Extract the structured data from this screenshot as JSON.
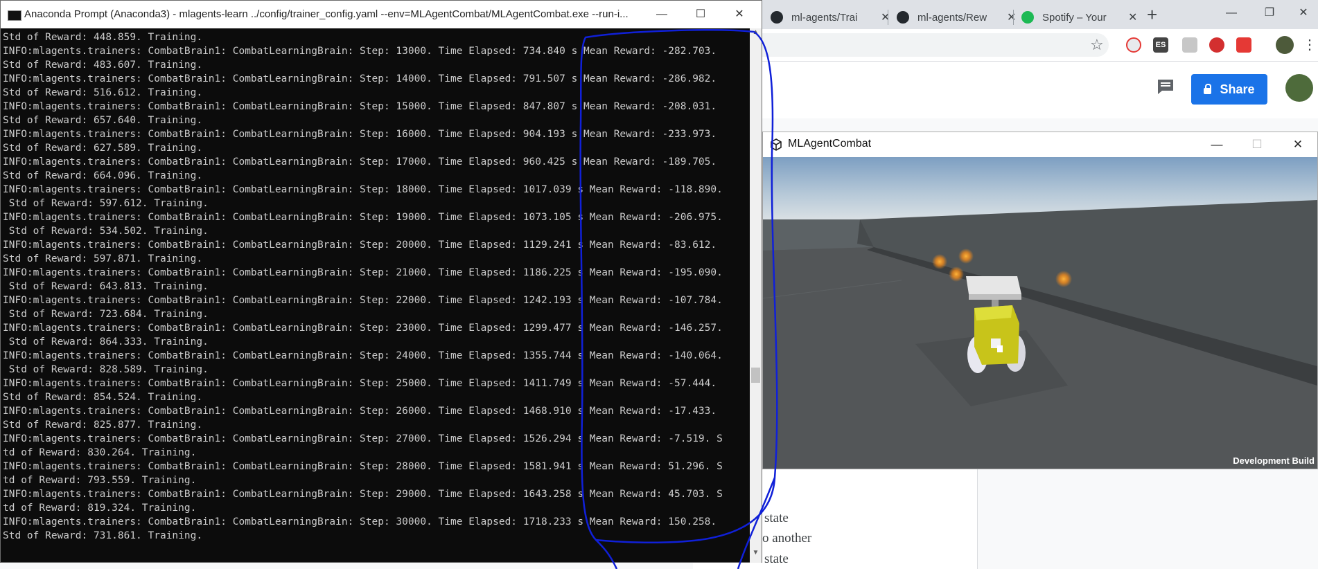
{
  "browser": {
    "tabs": [
      {
        "label": "ml-agents/Trai",
        "icon": "github-icon"
      },
      {
        "label": "ml-agents/Rew",
        "icon": "github-icon"
      },
      {
        "label": "Spotify – Your",
        "icon": "spotify-icon"
      }
    ],
    "tab_close": "✕",
    "new_tab": "+",
    "extensions": [
      "ES"
    ],
    "share_label": "Share",
    "colors": {
      "share": "#1a73e8",
      "spotify": "#1db954"
    }
  },
  "document": {
    "lines": [
      "state",
      "o another",
      "state"
    ]
  },
  "console": {
    "title": "Anaconda Prompt (Anaconda3) - mlagents-learn ../config/trainer_config.yaml --env=MLAgentCombat/MLAgentCombat.exe --run-i...",
    "lines": [
      "Std of Reward: 448.859. Training.",
      "INFO:mlagents.trainers: CombatBrain1: CombatLearningBrain: Step: 13000. Time Elapsed: 734.840 s Mean Reward: -282.703.",
      "Std of Reward: 483.607. Training.",
      "INFO:mlagents.trainers: CombatBrain1: CombatLearningBrain: Step: 14000. Time Elapsed: 791.507 s Mean Reward: -286.982.",
      "Std of Reward: 516.612. Training.",
      "INFO:mlagents.trainers: CombatBrain1: CombatLearningBrain: Step: 15000. Time Elapsed: 847.807 s Mean Reward: -208.031.",
      "Std of Reward: 657.640. Training.",
      "INFO:mlagents.trainers: CombatBrain1: CombatLearningBrain: Step: 16000. Time Elapsed: 904.193 s Mean Reward: -233.973.",
      "Std of Reward: 627.589. Training.",
      "INFO:mlagents.trainers: CombatBrain1: CombatLearningBrain: Step: 17000. Time Elapsed: 960.425 s Mean Reward: -189.705.",
      "Std of Reward: 664.096. Training.",
      "INFO:mlagents.trainers: CombatBrain1: CombatLearningBrain: Step: 18000. Time Elapsed: 1017.039 s Mean Reward: -118.890.",
      " Std of Reward: 597.612. Training.",
      "INFO:mlagents.trainers: CombatBrain1: CombatLearningBrain: Step: 19000. Time Elapsed: 1073.105 s Mean Reward: -206.975.",
      " Std of Reward: 534.502. Training.",
      "INFO:mlagents.trainers: CombatBrain1: CombatLearningBrain: Step: 20000. Time Elapsed: 1129.241 s Mean Reward: -83.612.",
      "Std of Reward: 597.871. Training.",
      "INFO:mlagents.trainers: CombatBrain1: CombatLearningBrain: Step: 21000. Time Elapsed: 1186.225 s Mean Reward: -195.090.",
      " Std of Reward: 643.813. Training.",
      "INFO:mlagents.trainers: CombatBrain1: CombatLearningBrain: Step: 22000. Time Elapsed: 1242.193 s Mean Reward: -107.784.",
      " Std of Reward: 723.684. Training.",
      "INFO:mlagents.trainers: CombatBrain1: CombatLearningBrain: Step: 23000. Time Elapsed: 1299.477 s Mean Reward: -146.257.",
      " Std of Reward: 864.333. Training.",
      "INFO:mlagents.trainers: CombatBrain1: CombatLearningBrain: Step: 24000. Time Elapsed: 1355.744 s Mean Reward: -140.064.",
      " Std of Reward: 828.589. Training.",
      "INFO:mlagents.trainers: CombatBrain1: CombatLearningBrain: Step: 25000. Time Elapsed: 1411.749 s Mean Reward: -57.444.",
      "Std of Reward: 854.524. Training.",
      "INFO:mlagents.trainers: CombatBrain1: CombatLearningBrain: Step: 26000. Time Elapsed: 1468.910 s Mean Reward: -17.433.",
      "Std of Reward: 825.877. Training.",
      "INFO:mlagents.trainers: CombatBrain1: CombatLearningBrain: Step: 27000. Time Elapsed: 1526.294 s Mean Reward: -7.519. S",
      "td of Reward: 830.264. Training.",
      "INFO:mlagents.trainers: CombatBrain1: CombatLearningBrain: Step: 28000. Time Elapsed: 1581.941 s Mean Reward: 51.296. S",
      "td of Reward: 793.559. Training.",
      "INFO:mlagents.trainers: CombatBrain1: CombatLearningBrain: Step: 29000. Time Elapsed: 1643.258 s Mean Reward: 45.703. S",
      "td of Reward: 819.324. Training.",
      "INFO:mlagents.trainers: CombatBrain1: CombatLearningBrain: Step: 30000. Time Elapsed: 1718.233 s Mean Reward: 150.258.",
      "Std of Reward: 731.861. Training."
    ]
  },
  "game": {
    "title": "MLAgentCombat",
    "watermark": "Development Build"
  },
  "annotation": {
    "color": "#1020d8"
  }
}
